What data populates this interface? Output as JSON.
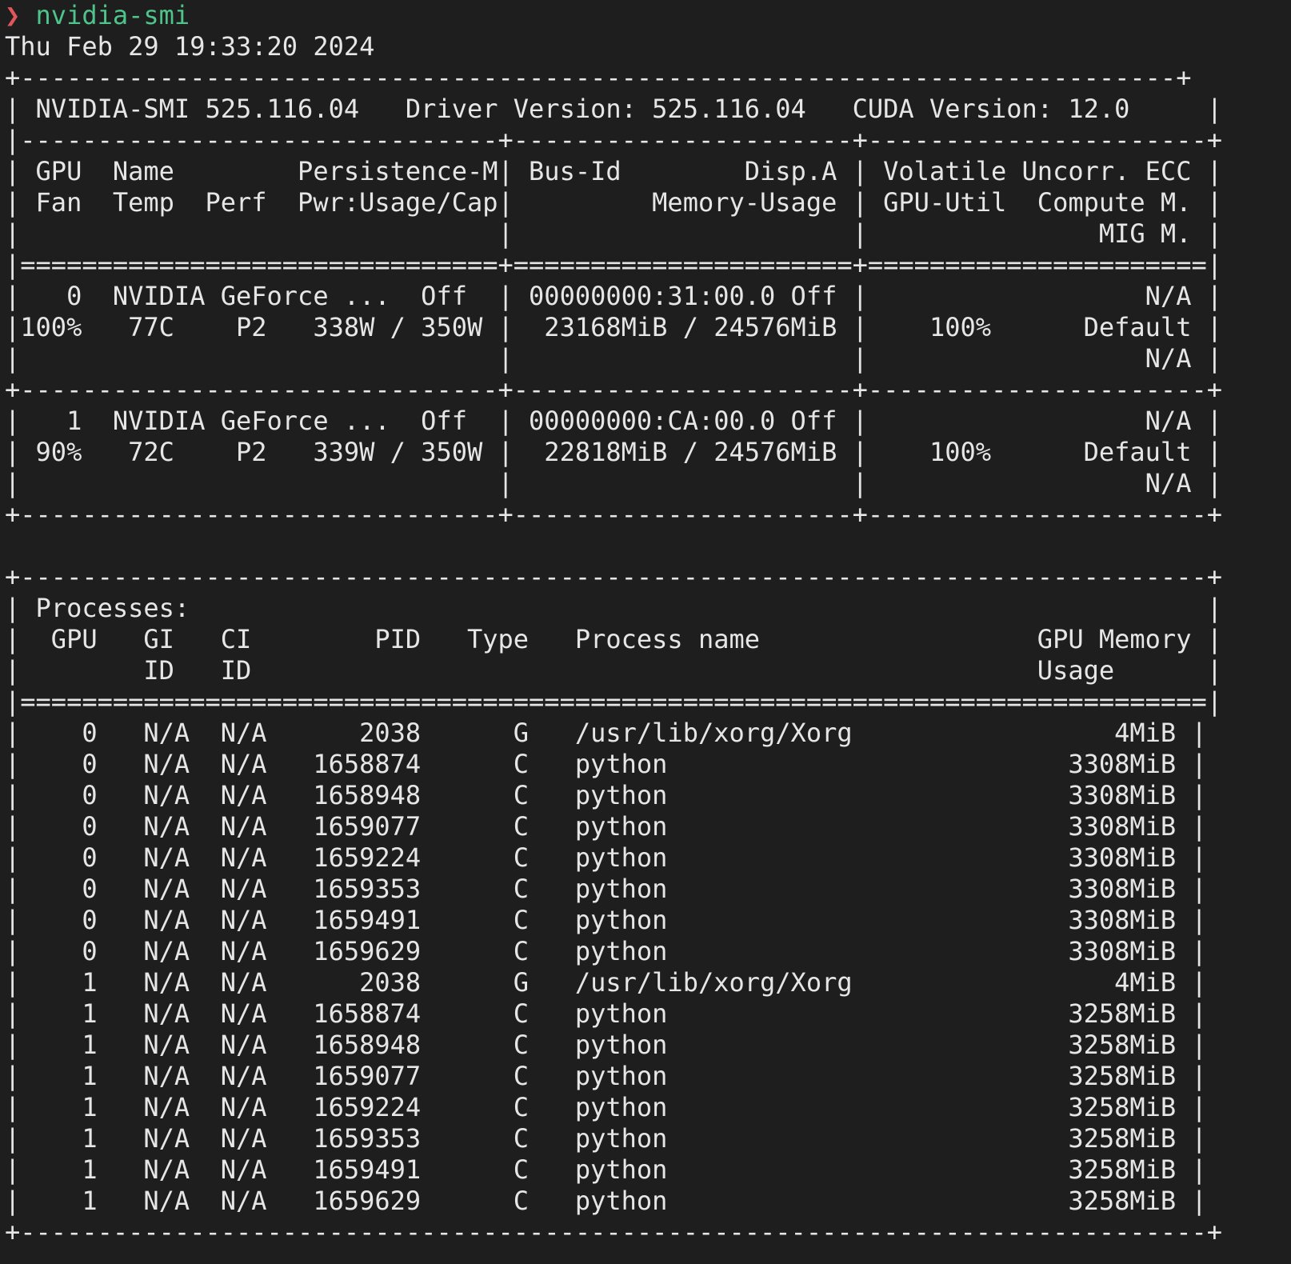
{
  "prompt": {
    "symbol": "❯",
    "command": "nvidia-smi"
  },
  "output_lines": [
    "Thu Feb 29 19:33:20 2024",
    "+---------------------------------------------------------------------------+",
    "| NVIDIA-SMI 525.116.04   Driver Version: 525.116.04   CUDA Version: 12.0     |",
    "|-------------------------------+----------------------+----------------------+",
    "| GPU  Name        Persistence-M| Bus-Id        Disp.A | Volatile Uncorr. ECC |",
    "| Fan  Temp  Perf  Pwr:Usage/Cap|         Memory-Usage | GPU-Util  Compute M. |",
    "|                               |                      |               MIG M. |",
    "|===============================+======================+======================|",
    "|   0  NVIDIA GeForce ...  Off  | 00000000:31:00.0 Off |                  N/A |",
    "|100%   77C    P2   338W / 350W |  23168MiB / 24576MiB |    100%      Default |",
    "|                               |                      |                  N/A |",
    "+-------------------------------+----------------------+----------------------+",
    "|   1  NVIDIA GeForce ...  Off  | 00000000:CA:00.0 Off |                  N/A |",
    "| 90%   72C    P2   339W / 350W |  22818MiB / 24576MiB |    100%      Default |",
    "|                               |                      |                  N/A |",
    "+-------------------------------+----------------------+----------------------+",
    "",
    "+-----------------------------------------------------------------------------+",
    "| Processes:                                                                  |",
    "|  GPU   GI   CI        PID   Type   Process name                  GPU Memory |",
    "|        ID   ID                                                   Usage      |",
    "|=============================================================================|",
    "|    0   N/A  N/A      2038      G   /usr/lib/xorg/Xorg                 4MiB |",
    "|    0   N/A  N/A   1658874      C   python                          3308MiB |",
    "|    0   N/A  N/A   1658948      C   python                          3308MiB |",
    "|    0   N/A  N/A   1659077      C   python                          3308MiB |",
    "|    0   N/A  N/A   1659224      C   python                          3308MiB |",
    "|    0   N/A  N/A   1659353      C   python                          3308MiB |",
    "|    0   N/A  N/A   1659491      C   python                          3308MiB |",
    "|    0   N/A  N/A   1659629      C   python                          3308MiB |",
    "|    1   N/A  N/A      2038      G   /usr/lib/xorg/Xorg                 4MiB |",
    "|    1   N/A  N/A   1658874      C   python                          3258MiB |",
    "|    1   N/A  N/A   1658948      C   python                          3258MiB |",
    "|    1   N/A  N/A   1659077      C   python                          3258MiB |",
    "|    1   N/A  N/A   1659224      C   python                          3258MiB |",
    "|    1   N/A  N/A   1659353      C   python                          3258MiB |",
    "|    1   N/A  N/A   1659491      C   python                          3258MiB |",
    "|    1   N/A  N/A   1659629      C   python                          3258MiB |",
    "+-----------------------------------------------------------------------------+"
  ],
  "colors": {
    "background": "#1e1e1e",
    "text": "#e6e6e6",
    "prompt_symbol": "#e0565b",
    "prompt_command": "#4ec48a"
  }
}
